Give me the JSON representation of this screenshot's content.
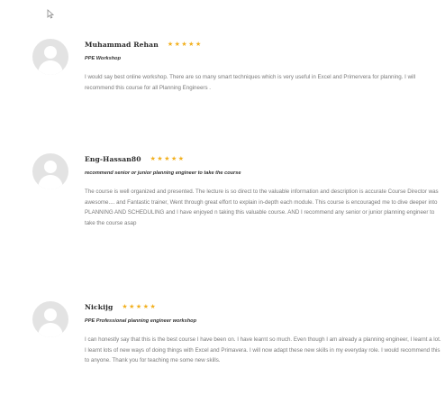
{
  "reviews": [
    {
      "author": "Muhammad Rehan",
      "rating": 5,
      "stars": [
        "★",
        "★",
        "★",
        "★",
        "★"
      ],
      "title": "PPE Workshop",
      "text": "I would say best online workshop. There are so many smart techniques which is very useful in Excel and Primervera for planning. I will recommend this course for all Planning Engineers ."
    },
    {
      "author": "Eng-Hassan80",
      "rating": 5,
      "stars": [
        "★",
        "★",
        "★",
        "★",
        "★"
      ],
      "title": "recommend senior or junior planning engineer to take the course",
      "text": "The course is well organized and presented. The lecture is so direct to the valuable information and description is accurate Course Director was awesome.... and Fantastic trainer, Went through great effort to explain in-depth each module. This course is encouraged me to dive deeper into PLANNING AND SCHEDULING and I have enjoyed n taking this valuable course. AND I recommend any senior or junior planning engineer to take the course asap"
    },
    {
      "author": "Nickijg",
      "rating": 5,
      "stars": [
        "★",
        "★",
        "★",
        "★",
        "★"
      ],
      "title": "PPE Professional planning engineer workshop",
      "text": "I can honestly say that this is the best course I have been on. I have learnt so much. Even though I am already a planning engineer, I learnt a lot. I learnt lots of new ways of doing things with Excel and Primavera. I will now adapt these new skills in my everyday role. I would recommend this to anyone. Thank you for teaching me some new skills."
    }
  ],
  "colors": {
    "star": "#f2b01e",
    "avatar_bg": "#e3e3e3",
    "avatar_fg": "#ffffff",
    "text": "#7a7a7a",
    "name": "#2b2b2b"
  },
  "icons": {
    "cursor": "mouse-pointer-icon",
    "avatar": "default-user-avatar-icon",
    "star": "star-icon"
  }
}
